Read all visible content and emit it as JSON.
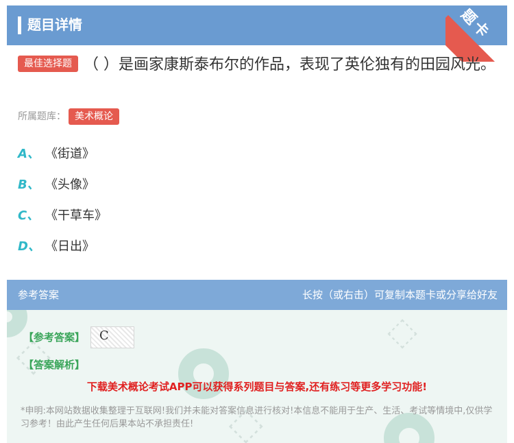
{
  "header": {
    "title": "题目详情"
  },
  "ribbon": {
    "label": "题卡"
  },
  "question": {
    "tag": "最佳选择题",
    "text": "（ ）是画家康斯泰布尔的作品，表现了英伦独有的田园风光。",
    "bank_label": "所属题库：",
    "bank_tag": "美术概论"
  },
  "options": [
    {
      "letter": "A、",
      "text": "《街道》"
    },
    {
      "letter": "B、",
      "text": "《头像》"
    },
    {
      "letter": "C、",
      "text": "《干草车》"
    },
    {
      "letter": "D、",
      "text": "《日出》"
    }
  ],
  "answer_section": {
    "title": "参考答案",
    "hint": "长按（或右击）可复制本题卡或分享给好友",
    "ref_label": "【参考答案】",
    "answer_value": "C",
    "analysis_label": "【答案解析】",
    "promo": "下载美术概论考试APP可以获得系列题目与答案,还有练习等更多学习功能!",
    "disclaimer": "*申明:本网站数据收集整理于互联网!我们并未能对答案信息进行核对!本信息不能用于生产、生活、考试等情境中,仅供学习参考！由此产生任何后果本站不承担责任!"
  },
  "colors": {
    "header": "#6a9bd1",
    "accent_red": "#e55a4f",
    "option_letter": "#30b8c8",
    "answer_green": "#3aa55a",
    "promo_red": "#e02020"
  }
}
